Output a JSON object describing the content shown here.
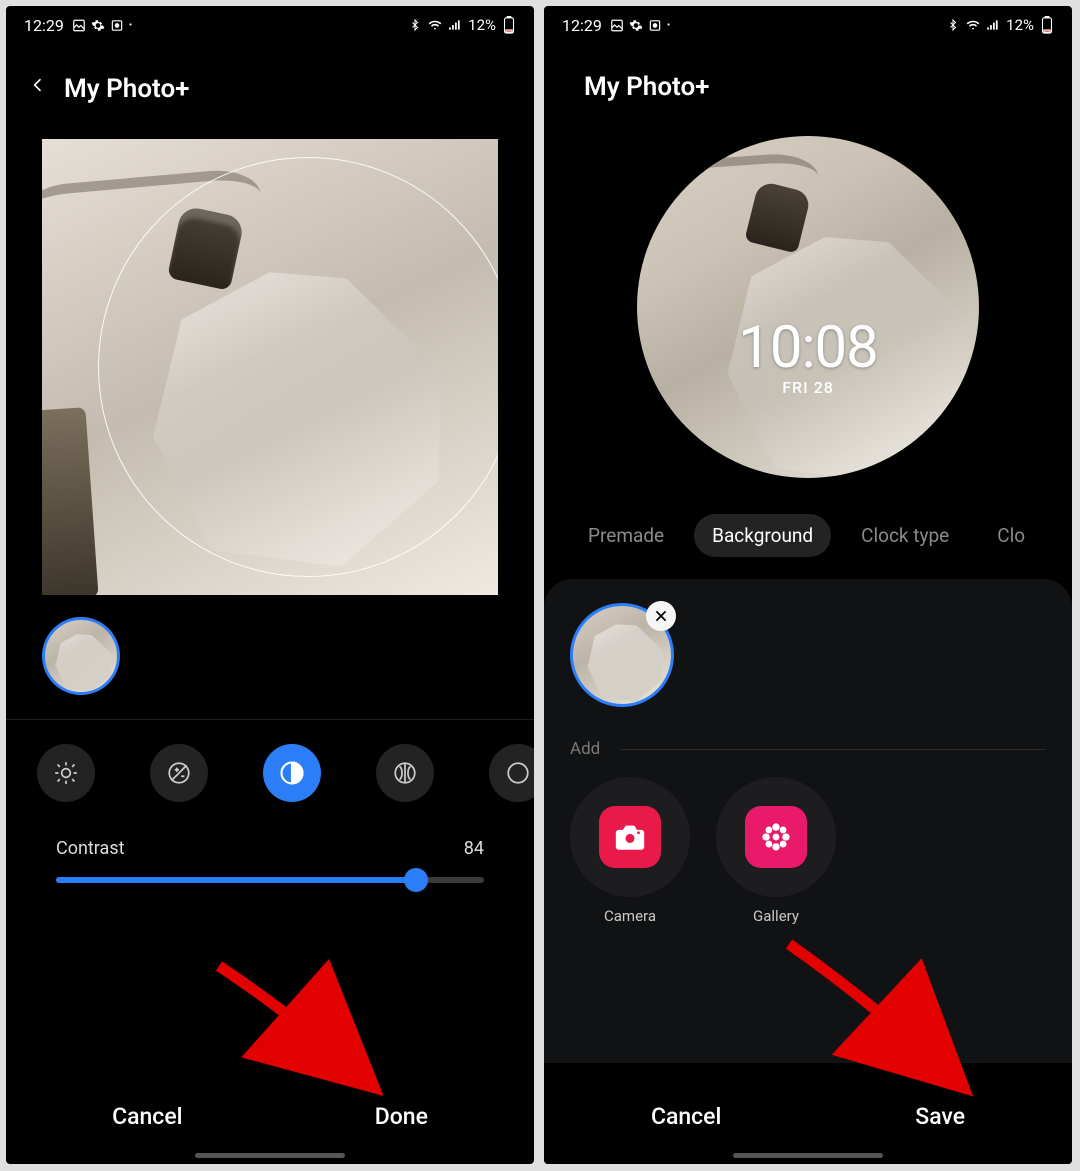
{
  "status": {
    "time": "12:29",
    "battery_text": "12%"
  },
  "left": {
    "title": "My Photo+",
    "adjust": {
      "label": "Contrast",
      "value": "84",
      "percent": 84
    },
    "buttons": {
      "cancel": "Cancel",
      "done": "Done"
    }
  },
  "right": {
    "title": "My Photo+",
    "clock": {
      "time": "10:08",
      "date": "FRI 28"
    },
    "tabs": {
      "premade": "Premade",
      "background": "Background",
      "clock_type": "Clock type",
      "clock_color_partial": "Clo"
    },
    "panel": {
      "add_label": "Add",
      "camera": "Camera",
      "gallery": "Gallery"
    },
    "buttons": {
      "cancel": "Cancel",
      "save": "Save"
    }
  }
}
